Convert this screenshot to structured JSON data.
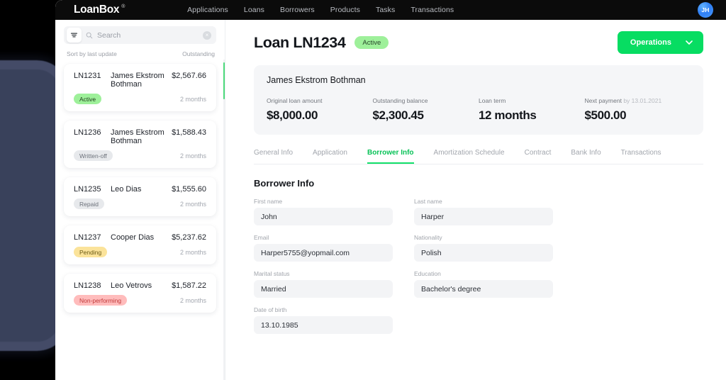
{
  "nav": {
    "brand": "LoanBox",
    "brand_mark": "®",
    "links": [
      "Applications",
      "Loans",
      "Borrowers",
      "Products",
      "Tasks",
      "Transactions"
    ],
    "avatar_initials": "JH"
  },
  "list_panel": {
    "search_placeholder": "Search",
    "filter_icon": "filter-icon",
    "search_icon": "search-icon",
    "clear_icon": "clear-icon",
    "sort_label": "Sort by last update",
    "sort_column": "Outstanding",
    "items": [
      {
        "id": "LN1231",
        "name": "James Ekstrom Bothman",
        "amount": "$2,567.66",
        "status": "Active",
        "status_class": "b-active",
        "term": "2 months"
      },
      {
        "id": "LN1236",
        "name": "James Ekstrom Bothman",
        "amount": "$1,588.43",
        "status": "Written-off",
        "status_class": "b-written",
        "term": "2 months"
      },
      {
        "id": "LN1235",
        "name": "Leo Dias",
        "amount": "$1,555.60",
        "status": "Repaid",
        "status_class": "b-repaid",
        "term": "2 months"
      },
      {
        "id": "LN1237",
        "name": "Cooper Dias",
        "amount": "$5,237.62",
        "status": "Pending",
        "status_class": "b-pending",
        "term": "2 months"
      },
      {
        "id": "LN1238",
        "name": "Leo Vetrovs",
        "amount": "$1,587.22",
        "status": "Non-performing",
        "status_class": "b-nonperf",
        "term": "2 months"
      }
    ]
  },
  "detail": {
    "title": "Loan LN1234",
    "title_status": "Active",
    "operations_label": "Operations",
    "summary": {
      "borrower_name": "James Ekstrom Bothman",
      "stats": [
        {
          "label": "Original loan amount",
          "label_muted": "",
          "value": "$8,000.00"
        },
        {
          "label": "Outstanding balance",
          "label_muted": "",
          "value": "$2,300.45"
        },
        {
          "label": "Loan term",
          "label_muted": "",
          "value": "12 months"
        },
        {
          "label": "Next payment",
          "label_muted": "by 13.01.2021",
          "value": "$500.00"
        }
      ]
    },
    "tabs": [
      {
        "label": "General Info",
        "active": false
      },
      {
        "label": "Application",
        "active": false
      },
      {
        "label": "Borrower Info",
        "active": true
      },
      {
        "label": "Amortization Schedule",
        "active": false
      },
      {
        "label": "Contract",
        "active": false
      },
      {
        "label": "Bank Info",
        "active": false
      },
      {
        "label": "Transactions",
        "active": false
      }
    ],
    "section_title": "Borrower Info",
    "fields": [
      {
        "label": "First name",
        "value": "John"
      },
      {
        "label": "Last name",
        "value": "Harper"
      },
      {
        "label": "Email",
        "value": "Harper5755@yopmail.com"
      },
      {
        "label": "Nationality",
        "value": "Polish"
      },
      {
        "label": "Marital status",
        "value": "Married"
      },
      {
        "label": "Education",
        "value": "Bachelor's degree"
      },
      {
        "label": "Date of birth",
        "value": "13.10.1985"
      }
    ]
  },
  "colors": {
    "accent_green": "#07dd62",
    "badge_green": "#9ef09a",
    "badge_yellow": "#fbe39a",
    "badge_red": "#ffbcbc",
    "nav_black": "#0b0b0b"
  }
}
